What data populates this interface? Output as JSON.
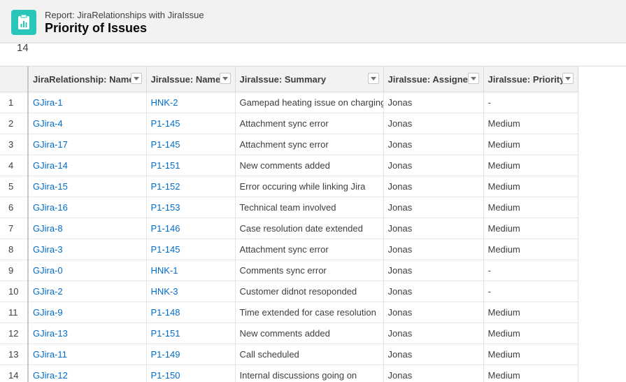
{
  "header": {
    "subtitle": "Report: JiraRelationships with JiraIssue",
    "title": "Priority of Issues",
    "icon": "report-icon",
    "icon_color": "#2ac6b9"
  },
  "record_count": "14",
  "table": {
    "columns": [
      "JiraRelationship: Name",
      "JiraIssue: Name",
      "JiraIssue: Summary",
      "JiraIssue: Assignee",
      "JiraIssue: Priority"
    ],
    "rows": [
      {
        "num": "1",
        "rel": "GJira-1",
        "issue": "HNK-2",
        "summary": "Gamepad heating issue on charging",
        "assignee": "Jonas",
        "priority": "-"
      },
      {
        "num": "2",
        "rel": "GJira-4",
        "issue": "P1-145",
        "summary": "Attachment sync error",
        "assignee": "Jonas",
        "priority": "Medium"
      },
      {
        "num": "3",
        "rel": "GJira-17",
        "issue": "P1-145",
        "summary": "Attachment sync error",
        "assignee": "Jonas",
        "priority": "Medium"
      },
      {
        "num": "4",
        "rel": "GJira-14",
        "issue": "P1-151",
        "summary": "New comments added",
        "assignee": "Jonas",
        "priority": "Medium"
      },
      {
        "num": "5",
        "rel": "GJira-15",
        "issue": "P1-152",
        "summary": "Error occuring while linking Jira",
        "assignee": "Jonas",
        "priority": "Medium"
      },
      {
        "num": "6",
        "rel": "GJira-16",
        "issue": "P1-153",
        "summary": "Technical team involved",
        "assignee": "Jonas",
        "priority": "Medium"
      },
      {
        "num": "7",
        "rel": "GJira-8",
        "issue": "P1-146",
        "summary": "Case resolution date extended",
        "assignee": "Jonas",
        "priority": "Medium"
      },
      {
        "num": "8",
        "rel": "GJira-3",
        "issue": "P1-145",
        "summary": "Attachment sync error",
        "assignee": "Jonas",
        "priority": "Medium"
      },
      {
        "num": "9",
        "rel": "GJira-0",
        "issue": "HNK-1",
        "summary": "Comments sync error",
        "assignee": "Jonas",
        "priority": "-"
      },
      {
        "num": "10",
        "rel": "GJira-2",
        "issue": "HNK-3",
        "summary": "Customer didnot resoponded",
        "assignee": "Jonas",
        "priority": "-"
      },
      {
        "num": "11",
        "rel": "GJira-9",
        "issue": "P1-148",
        "summary": "Time extended for case resolution",
        "assignee": "Jonas",
        "priority": "Medium"
      },
      {
        "num": "12",
        "rel": "GJira-13",
        "issue": "P1-151",
        "summary": "New comments added",
        "assignee": "Jonas",
        "priority": "Medium"
      },
      {
        "num": "13",
        "rel": "GJira-11",
        "issue": "P1-149",
        "summary": "Call scheduled",
        "assignee": "Jonas",
        "priority": "Medium"
      },
      {
        "num": "14",
        "rel": "GJira-12",
        "issue": "P1-150",
        "summary": "Internal discussions going on",
        "assignee": "Jonas",
        "priority": "Medium"
      }
    ]
  },
  "colors": {
    "link": "#006dcc",
    "header_bg": "#f3f2f2"
  }
}
